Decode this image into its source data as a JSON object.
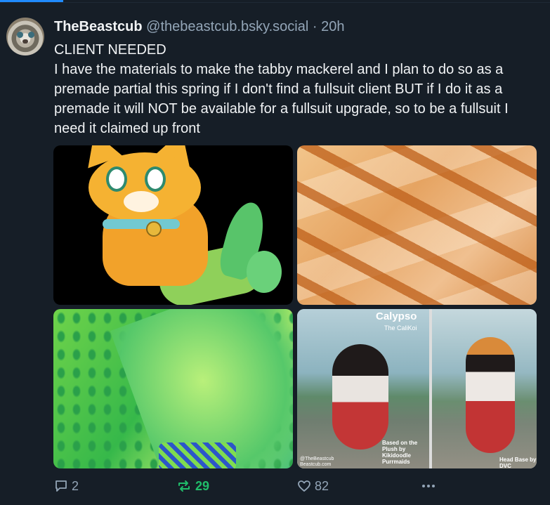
{
  "post": {
    "display_name": "TheBeastcub",
    "handle": "@thebeastcub.bsky.social",
    "separator": "·",
    "time": "20h",
    "text_heading": "CLIENT NEEDED",
    "text_body": "I have the materials to make the tabby mackerel and I plan to do so as a premade partial this spring if I don't find a fullsuit client BUT if I do it as a premade it will NOT be available for a fullsuit upgrade, so to be a fullsuit I need it claimed up front"
  },
  "gallery": {
    "image4": {
      "title": "Calypso",
      "subtitle": "The CaliKoi",
      "note": "Based on the Plush by Kikidoodle Purrmaids",
      "credit_line1": "@TheBeastcub",
      "credit_line2": "Beastcub.com",
      "head_note": "Head Base by DVC"
    }
  },
  "actions": {
    "reply_count": "2",
    "repost_count": "29",
    "like_count": "82",
    "reply_icon": "speech-bubble-icon",
    "repost_icon": "repost-arrows-icon",
    "like_icon": "heart-icon",
    "more_icon": "ellipsis-icon"
  },
  "colors": {
    "background": "#161e27",
    "text": "#f1f3f5",
    "muted": "#93a5b7",
    "repost_active": "#20bc6a",
    "accent": "#208bfe"
  }
}
